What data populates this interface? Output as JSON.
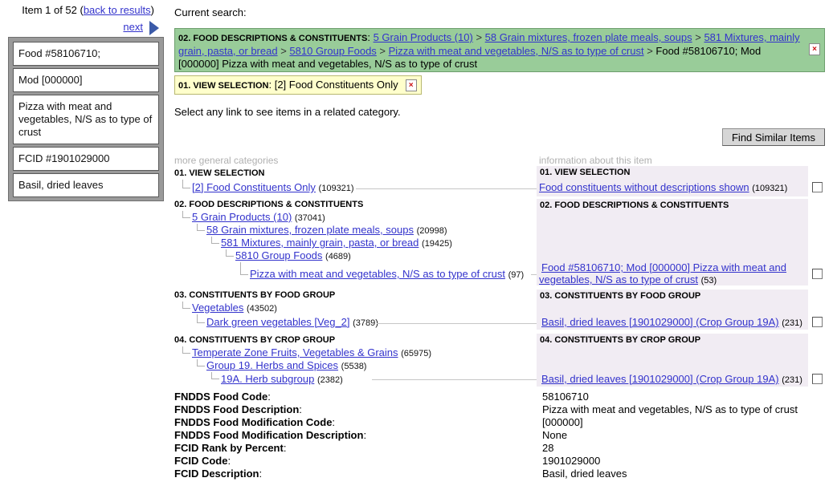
{
  "nav": {
    "item_prefix": "Item 1 of 52 (",
    "back_label": "back to results",
    "item_suffix": ")",
    "next_label": "next"
  },
  "item_summary": [
    "Food #58106710;",
    "Mod [000000]",
    "Pizza with meat and vegetables, N/S as to type of crust",
    "FCID #1901029000",
    "Basil, dried leaves"
  ],
  "search": {
    "label": "Current search:",
    "criteria": {
      "label": "02. FOOD DESCRIPTIONS & CONSTITUENTS",
      "links": [
        "5 Grain Products (10)",
        "58 Grain mixtures, frozen plate meals, soups",
        "581 Mixtures, mainly grain, pasta, or bread",
        "5810 Group Foods",
        "Pizza with meat and vegetables, N/S as to type of crust"
      ],
      "final": "Food #58106710; Mod [000000] Pizza with meat and vegetables, N/S as to type of crust"
    },
    "view": {
      "label": "01. VIEW SELECTION",
      "value": "[2] Food Constituents Only"
    },
    "remove_icon": "×"
  },
  "related_hint": "Select any link to see items in a related category.",
  "find_similar_label": "Find Similar Items",
  "columns": {
    "general": "more general categories",
    "info": "information about this item"
  },
  "sections": {
    "view": {
      "title": "01. VIEW SELECTION",
      "tree": [
        {
          "label": "[2] Food Constituents Only",
          "count": "(109321)"
        }
      ],
      "info_title": "01. VIEW SELECTION",
      "info_link": "Food constituents without descriptions shown",
      "info_count": "(109321)"
    },
    "food": {
      "title": "02. FOOD DESCRIPTIONS & CONSTITUENTS",
      "tree": [
        {
          "label": "5 Grain Products (10)",
          "count": "(37041)"
        },
        {
          "label": "58 Grain mixtures, frozen plate meals, soups",
          "count": "(20998)"
        },
        {
          "label": "581 Mixtures, mainly grain, pasta, or bread",
          "count": "(19425)"
        },
        {
          "label": "5810 Group Foods",
          "count": "(4689)"
        },
        {
          "label": "Pizza with meat and vegetables, N/S as to type of crust",
          "count": "(97)"
        }
      ],
      "info_title": "02. FOOD DESCRIPTIONS & CONSTITUENTS",
      "info_link_line1": "Food #58106710; Mod [000000] Pizza with meat and",
      "info_link_line2": "vegetables, N/S as to type of crust",
      "info_count": "(53)"
    },
    "food_group": {
      "title": "03. CONSTITUENTS BY FOOD GROUP",
      "tree": [
        {
          "label": "Vegetables",
          "count": "(43502)"
        },
        {
          "label": "Dark green vegetables [Veg_2]",
          "count": "(3789)"
        }
      ],
      "info_title": "03. CONSTITUENTS BY FOOD GROUP",
      "info_link": "Basil, dried leaves [1901029000] (Crop Group 19A)",
      "info_count": "(231)"
    },
    "crop_group": {
      "title": "04. CONSTITUENTS BY CROP GROUP",
      "tree": [
        {
          "label": "Temperate Zone Fruits, Vegetables & Grains",
          "count": "(65975)"
        },
        {
          "label": "Group 19. Herbs and Spices",
          "count": "(5538)"
        },
        {
          "label": "19A. Herb subgroup",
          "count": "(2382)"
        }
      ],
      "info_title": "04. CONSTITUENTS BY CROP GROUP",
      "info_link": "Basil, dried leaves [1901029000] (Crop Group 19A)",
      "info_count": "(231)"
    }
  },
  "details": [
    {
      "label": "FNDDS Food Code",
      "value": "58106710"
    },
    {
      "label": "FNDDS Food Description",
      "value": "Pizza with meat and vegetables, N/S as to type of crust"
    },
    {
      "label": "FNDDS Food Modification Code",
      "value": "[000000]"
    },
    {
      "label": "FNDDS Food Modification Description",
      "value": "None"
    },
    {
      "label": "FCID Rank by Percent",
      "value": "28"
    },
    {
      "label": "FCID Code",
      "value": "1901029000"
    },
    {
      "label": "FCID Description",
      "value": "Basil, dried leaves"
    }
  ],
  "colon": ":",
  "gt": " > "
}
